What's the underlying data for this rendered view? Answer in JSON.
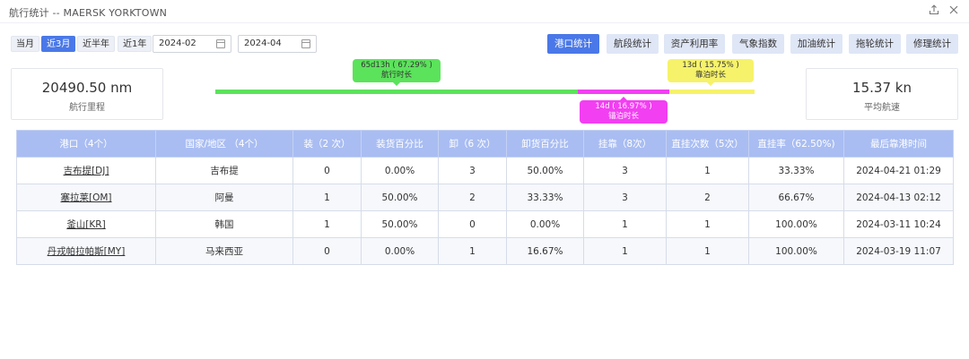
{
  "window": {
    "title": "航行统计 -- MAERSK YORKTOWN"
  },
  "icons": {
    "export": "export-icon",
    "close": "close-icon",
    "calendar": "calendar-icon"
  },
  "ranges": [
    {
      "label": "当月",
      "active": false
    },
    {
      "label": "近3月",
      "active": true
    },
    {
      "label": "近半年",
      "active": false
    },
    {
      "label": "近1年",
      "active": false
    }
  ],
  "dates": {
    "start": "2024-02",
    "end": "2024-04"
  },
  "stat_tabs": [
    {
      "label": "港口统计",
      "active": true
    },
    {
      "label": "航段统计",
      "active": false
    },
    {
      "label": "资产利用率",
      "active": false
    },
    {
      "label": "气象指数",
      "active": false
    },
    {
      "label": "加油统计",
      "active": false
    },
    {
      "label": "拖轮统计",
      "active": false
    },
    {
      "label": "修理统计",
      "active": false
    }
  ],
  "summary": {
    "distance_value": "20490.50 nm",
    "distance_label": "航行里程",
    "speed_value": "15.37 kn",
    "speed_label": "平均航速"
  },
  "timeline": {
    "sailing": {
      "line1": "65d13h ( 67.29% )",
      "line2": "航行时长",
      "fraction": 0.6729,
      "color": "#5be35b"
    },
    "anchoring": {
      "line1": "14d ( 16.97% )",
      "line2": "锚泊时长",
      "fraction": 0.1697,
      "color": "#f23ff2"
    },
    "berthing": {
      "line1": "13d ( 15.75% )",
      "line2": "靠泊时长",
      "fraction": 0.1575,
      "color": "#f6f26a"
    }
  },
  "table": {
    "header_color": "#a9bdf2",
    "headers": [
      "港口（4个）",
      "国家/地区 （4个）",
      "装（2 次）",
      "装货百分比",
      "卸（6 次）",
      "卸货百分比",
      "挂靠（8次）",
      "直挂次数（5次）",
      "直挂率（62.50%)",
      "最后靠港时间"
    ],
    "rows": [
      [
        "吉布提[DJ]",
        "吉布提",
        "0",
        "0.00%",
        "3",
        "50.00%",
        "3",
        "1",
        "33.33%",
        "2024-04-21 01:29"
      ],
      [
        "塞拉莱[OM]",
        "阿曼",
        "1",
        "50.00%",
        "2",
        "33.33%",
        "3",
        "2",
        "66.67%",
        "2024-04-13 02:12"
      ],
      [
        "釜山[KR]",
        "韩国",
        "1",
        "50.00%",
        "0",
        "0.00%",
        "1",
        "1",
        "100.00%",
        "2024-03-11 10:24"
      ],
      [
        "丹戎帕拉帕斯[MY]",
        "马来西亚",
        "0",
        "0.00%",
        "1",
        "16.67%",
        "1",
        "1",
        "100.00%",
        "2024-03-19 11:07"
      ]
    ]
  }
}
